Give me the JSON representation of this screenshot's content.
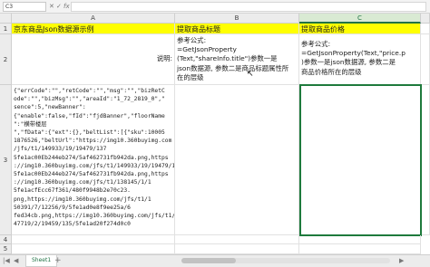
{
  "formula_bar": {
    "cell_ref": "C3",
    "fx_label": "fx",
    "formula": ""
  },
  "columns": [
    "A",
    "B",
    "C"
  ],
  "rows": [
    "1",
    "2",
    "3",
    "4",
    "5"
  ],
  "row1": {
    "a": "京东商品Json数据源示例",
    "b": "提取商品标题",
    "c": "提取商品价格"
  },
  "row2": {
    "a": "说明:",
    "b": "参考公式:\n=GetJsonProperty\n(Text,\"shareInfo.title\")参数一是\njson数据源, 参数二是商品标题属性所\n在的层级",
    "c": "参考公式:\n=GetJsonProperty(Text,\"price.p\n)参数一是json数据源, 参数二是\n商品价格所在的层级"
  },
  "row3": {
    "a": "{\"errCode\":\"\",\"retCode\":\"\",\"msg\":\"\",\"bizRetC\node\":\"\",\"bizMsg\":\"\",\"areaId\":\"1_72_2819_0\",\"\nsence\":5,\"newBanner\":\n{\"enable\":false,\"fId\":\"fjdBanner\",\"floorName\n\":\"横带楼层\n\",\"fData\":{\"ext\":{},\"beltList\":[{\"sku\":10005\n1876526,\"beltUrl\":\"https://img10.360buyimg.com\n/jfs/t1/149933/19/19479/137\n5fe1ac00Eb244eb274/5af462731fb942da.png,https\n://img10.360buyimg.com/jfs/t1/149933/19/19479/137\n5fe1ac00Eb244eb274/5af462731fb942da.png,https\n://img10.360buyimg.com/jfs/t1/138145/1/1\n5fe1acfEcc67f361/480f9948b2e70c23.\npng,https://img10.360buyimg.com/jfs/t1/1\n50391/7/12256/9/5fe1ad0e8f9ee25a/6\nfed34cb.png,https://img10.360buyimg.com/jfs/t1/1\n47719/2/19459/135/5fe1ad20f274d0c0"
  },
  "sheet_tab": "Sheet1",
  "nav": {
    "first": "|◀",
    "prev": "◀",
    "next": "▶",
    "add": "+"
  }
}
